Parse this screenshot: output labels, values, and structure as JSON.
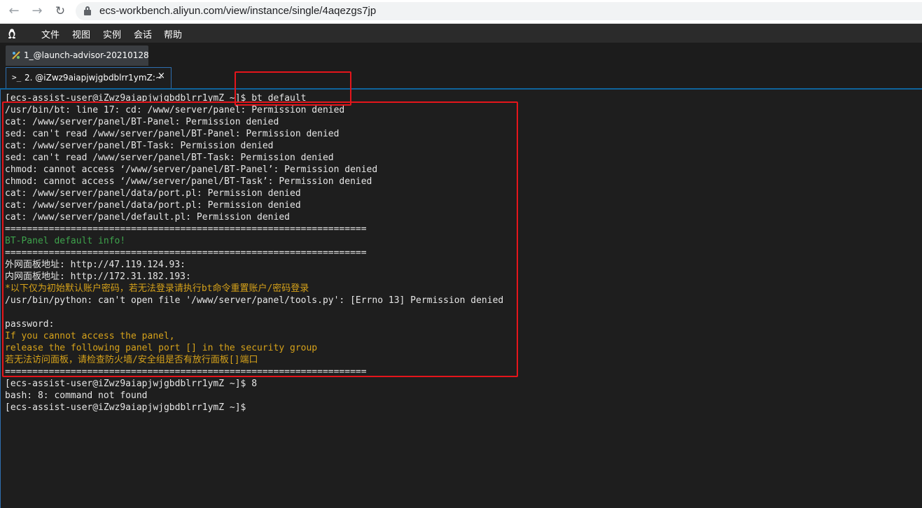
{
  "browser": {
    "url": "ecs-workbench.aliyun.com/view/instance/single/4aqezgs7jp",
    "back_icon": "arrow-left-icon",
    "forward_icon": "arrow-right-icon",
    "reload_icon": "reload-icon",
    "lock_icon": "lock-icon"
  },
  "menu": {
    "os_icon": "linux-penguin-icon",
    "items": [
      "文件",
      "视图",
      "实例",
      "会话",
      "帮助"
    ]
  },
  "tabs": {
    "session_tab": "1_@launch-advisor-20210128",
    "terminal_tab": "2. @iZwz9aiapjwjgbdblrr1ymZ:~",
    "close_icon": "close-icon"
  },
  "terminal": {
    "lines": [
      {
        "text": "[ecs-assist-user@iZwz9aiapjwjgbdblrr1ymZ ~]$ bt default",
        "color": "#e6e6e6"
      },
      {
        "text": "/usr/bin/bt: line 17: cd: /www/server/panel: Permission denied",
        "color": "#e6e6e6"
      },
      {
        "text": "cat: /www/server/panel/BT-Panel: Permission denied",
        "color": "#e6e6e6"
      },
      {
        "text": "sed: can't read /www/server/panel/BT-Panel: Permission denied",
        "color": "#e6e6e6"
      },
      {
        "text": "cat: /www/server/panel/BT-Task: Permission denied",
        "color": "#e6e6e6"
      },
      {
        "text": "sed: can't read /www/server/panel/BT-Task: Permission denied",
        "color": "#e6e6e6"
      },
      {
        "text": "chmod: cannot access ‘/www/server/panel/BT-Panel’: Permission denied",
        "color": "#e6e6e6"
      },
      {
        "text": "chmod: cannot access ‘/www/server/panel/BT-Task’: Permission denied",
        "color": "#e6e6e6"
      },
      {
        "text": "cat: /www/server/panel/data/port.pl: Permission denied",
        "color": "#e6e6e6"
      },
      {
        "text": "cat: /www/server/panel/data/port.pl: Permission denied",
        "color": "#e6e6e6"
      },
      {
        "text": "cat: /www/server/panel/default.pl: Permission denied",
        "color": "#e6e6e6"
      },
      {
        "text": "==================================================================",
        "color": "#e6e6e6"
      },
      {
        "text": "BT-Panel default info!",
        "color": "#3ea34c"
      },
      {
        "text": "==================================================================",
        "color": "#e6e6e6"
      },
      {
        "text": "外网面板地址: http://47.119.124.93:",
        "color": "#e6e6e6"
      },
      {
        "text": "内网面板地址: http://172.31.182.193:",
        "color": "#e6e6e6"
      },
      {
        "text": "*以下仅为初始默认账户密码，若无法登录请执行bt命令重置账户/密码登录",
        "color": "#d6a21a"
      },
      {
        "text": "/usr/bin/python: can't open file '/www/server/panel/tools.py': [Errno 13] Permission denied",
        "color": "#e6e6e6"
      },
      {
        "text": "",
        "color": "#e6e6e6"
      },
      {
        "text": "password:",
        "color": "#e6e6e6"
      },
      {
        "text": "If you cannot access the panel,",
        "color": "#d6a21a"
      },
      {
        "text": "release the following panel port [] in the security group",
        "color": "#d6a21a"
      },
      {
        "text": "若无法访问面板，请检查防火墙/安全组是否有放行面板[]端口",
        "color": "#d6a21a"
      },
      {
        "text": "==================================================================",
        "color": "#e6e6e6"
      },
      {
        "text": "[ecs-assist-user@iZwz9aiapjwjgbdblrr1ymZ ~]$ 8",
        "color": "#e6e6e6"
      },
      {
        "text": "bash: 8: command not found",
        "color": "#e6e6e6"
      },
      {
        "text": "[ecs-assist-user@iZwz9aiapjwjgbdblrr1ymZ ~]$",
        "color": "#e6e6e6"
      }
    ]
  },
  "annotations": {
    "box_color": "#e5151b"
  }
}
